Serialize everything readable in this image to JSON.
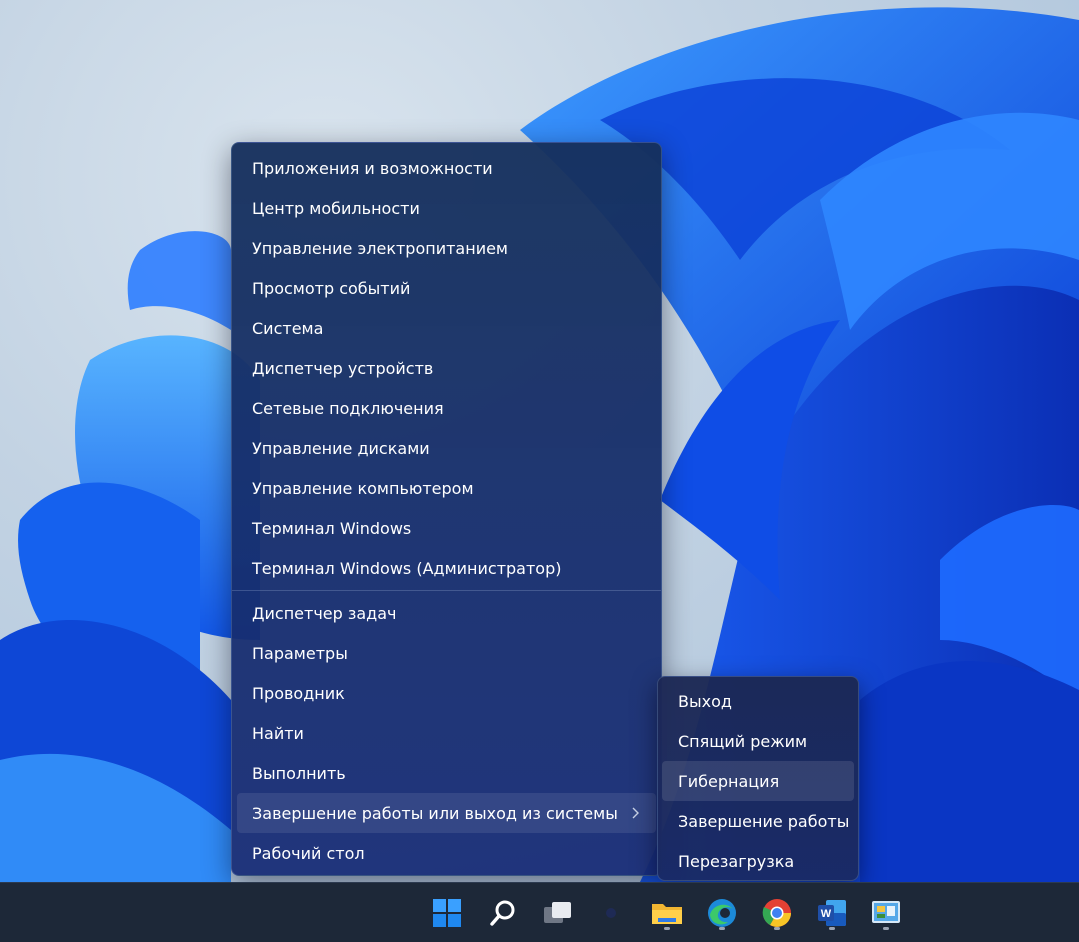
{
  "colors": {
    "menu_bg": "#1a2e6a",
    "menu_text": "#ffffff",
    "taskbar_bg": "#1d2838",
    "accent": "#1e6ff0"
  },
  "main_menu": {
    "group1": [
      {
        "label": "Приложения и возможности"
      },
      {
        "label": "Центр мобильности"
      },
      {
        "label": "Управление электропитанием"
      },
      {
        "label": "Просмотр событий"
      },
      {
        "label": "Система"
      },
      {
        "label": "Диспетчер устройств"
      },
      {
        "label": "Сетевые подключения"
      },
      {
        "label": "Управление дисками"
      },
      {
        "label": "Управление компьютером"
      },
      {
        "label": "Терминал Windows"
      },
      {
        "label": "Терминал Windows (Администратор)"
      }
    ],
    "group2": [
      {
        "label": "Диспетчер задач"
      },
      {
        "label": "Параметры"
      },
      {
        "label": "Проводник"
      },
      {
        "label": "Найти"
      },
      {
        "label": "Выполнить"
      },
      {
        "label": "Завершение работы или выход из системы",
        "has_submenu": true,
        "active": true
      },
      {
        "label": "Рабочий стол"
      }
    ]
  },
  "submenu": {
    "items": [
      {
        "label": "Выход"
      },
      {
        "label": "Спящий режим"
      },
      {
        "label": "Гибернация",
        "hover": true
      },
      {
        "label": "Завершение работы"
      },
      {
        "label": "Перезагрузка"
      }
    ]
  },
  "taskbar": {
    "icons": [
      {
        "name": "start-icon"
      },
      {
        "name": "search-icon"
      },
      {
        "name": "task-view-icon"
      },
      {
        "name": "widgets-icon"
      },
      {
        "name": "file-explorer-icon",
        "running": true
      },
      {
        "name": "edge-icon",
        "running": true
      },
      {
        "name": "chrome-icon",
        "running": true
      },
      {
        "name": "word-icon",
        "running": true
      },
      {
        "name": "control-panel-icon",
        "running": true
      }
    ]
  }
}
